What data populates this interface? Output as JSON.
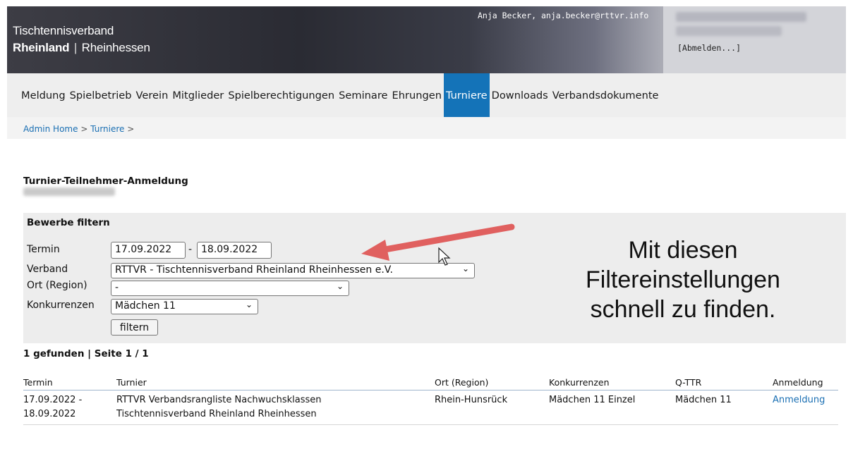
{
  "header": {
    "brand_line1": "Tischtennisverband",
    "brand_bold": "Rheinland",
    "brand_sep": "|",
    "brand_rest": "Rheinhessen",
    "user": "Anja Becker, anja.becker@rttvr.info",
    "logout": "[Abmelden...]"
  },
  "nav": {
    "items": [
      {
        "label": "Meldung"
      },
      {
        "label": "Spielbetrieb"
      },
      {
        "label": "Verein"
      },
      {
        "label": "Mitglieder"
      },
      {
        "label": "Spielberechtigungen"
      },
      {
        "label": "Seminare"
      },
      {
        "label": "Ehrungen"
      },
      {
        "label": "Turniere",
        "active": true
      },
      {
        "label": "Downloads"
      },
      {
        "label": "Verbandsdokumente"
      }
    ],
    "active_color": "#1473b8"
  },
  "breadcrumb": {
    "home": "Admin Home",
    "sep1": ">",
    "turniere": "Turniere",
    "sep2": ">"
  },
  "page": {
    "title": "Turnier-Teilnehmer-Anmeldung"
  },
  "filter": {
    "title": "Bewerbe filtern",
    "termin_label": "Termin",
    "date_from": "17.09.2022",
    "date_sep": "-",
    "date_to": "18.09.2022",
    "verband_label": "Verband",
    "verband_value": "RTTVR - Tischtennisverband Rheinland Rheinhessen e.V.",
    "ort_label": "Ort (Region)",
    "ort_value": "-",
    "konkurrenzen_label": "Konkurrenzen",
    "konkurrenzen_value": "Mädchen 11",
    "button_label": "filtern"
  },
  "annotation": {
    "line1": "Mit diesen",
    "line2": "Filtereinstellungen",
    "line3": "schnell zu finden.",
    "arrow_color": "#e0605f"
  },
  "results": {
    "summary": "1 gefunden | Seite 1 / 1",
    "columns": [
      "Termin",
      "Turnier",
      "Ort (Region)",
      "Konkurrenzen",
      "Q-TTR",
      "Anmeldung"
    ],
    "rows": [
      {
        "termin_1": "17.09.2022 -",
        "termin_2": "18.09.2022",
        "turnier_1": "RTTVR Verbandsrangliste Nachwuchsklassen",
        "turnier_2": "Tischtennisverband Rheinland Rheinhessen",
        "ort": "Rhein-Hunsrück",
        "konkurrenzen": "Mädchen 11 Einzel",
        "qttr": "Mädchen 11",
        "anmeldung": "Anmeldung"
      }
    ]
  }
}
